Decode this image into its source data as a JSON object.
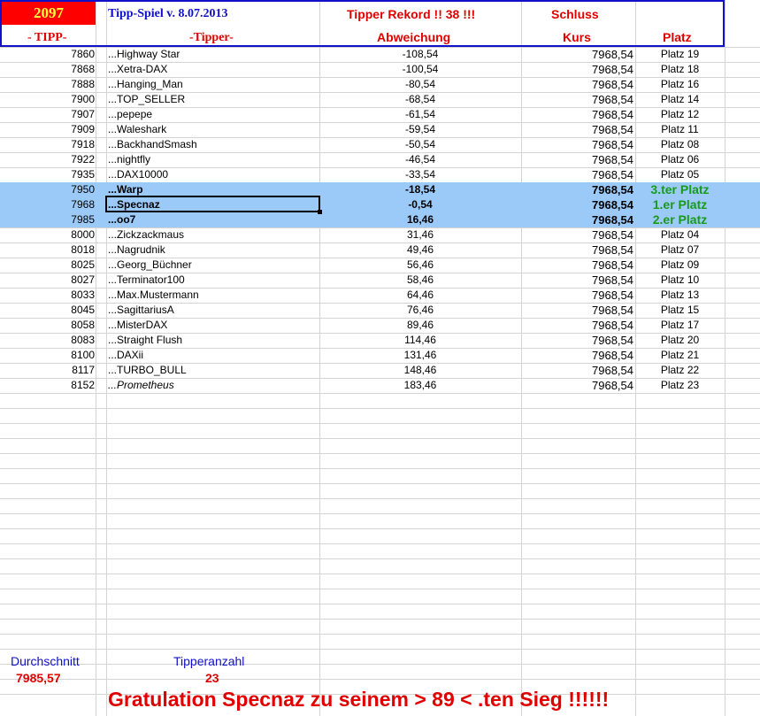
{
  "header": {
    "year": "2097",
    "title": "Tipp-Spiel v. 8.07.2013",
    "rekord": "Tipper Rekord !!  38  !!!",
    "schluss": "Schluss",
    "col_tipp": "- TIPP-",
    "col_tipper": "-Tipper-",
    "col_abweichung": "Abweichung",
    "col_kurs": "Kurs",
    "col_platz": "Platz"
  },
  "rows": [
    {
      "tipp": "7860",
      "name": "...Highway Star",
      "abw": "-108,54",
      "kurs": "7968,54",
      "platz": "Platz 19"
    },
    {
      "tipp": "7868",
      "name": "...Xetra-DAX",
      "abw": "-100,54",
      "kurs": "7968,54",
      "platz": "Platz 18"
    },
    {
      "tipp": "7888",
      "name": "...Hanging_Man",
      "abw": "-80,54",
      "kurs": "7968,54",
      "platz": "Platz 16"
    },
    {
      "tipp": "7900",
      "name": "...TOP_SELLER",
      "abw": "-68,54",
      "kurs": "7968,54",
      "platz": "Platz 14"
    },
    {
      "tipp": "7907",
      "name": "...pepepe",
      "abw": "-61,54",
      "kurs": "7968,54",
      "platz": "Platz 12"
    },
    {
      "tipp": "7909",
      "name": "...Waleshark",
      "abw": "-59,54",
      "kurs": "7968,54",
      "platz": "Platz 11"
    },
    {
      "tipp": "7918",
      "name": "...BackhandSmash",
      "abw": "-50,54",
      "kurs": "7968,54",
      "platz": "Platz 08"
    },
    {
      "tipp": "7922",
      "name": "...nightfly",
      "abw": "-46,54",
      "kurs": "7968,54",
      "platz": "Platz 06"
    },
    {
      "tipp": "7935",
      "name": "...DAX10000",
      "abw": "-33,54",
      "kurs": "7968,54",
      "platz": "Platz 05"
    },
    {
      "tipp": "7950",
      "name": "...Warp",
      "abw": "-18,54",
      "kurs": "7968,54",
      "platz": "3.ter Platz",
      "hl": true
    },
    {
      "tipp": "7968",
      "name": "...Specnaz",
      "abw": "-0,54",
      "kurs": "7968,54",
      "platz": "1.er Platz",
      "hl": true
    },
    {
      "tipp": "7985",
      "name": "...oo7",
      "abw": "16,46",
      "kurs": "7968,54",
      "platz": "2.er Platz",
      "hl": true
    },
    {
      "tipp": "8000",
      "name": "...Zickzackmaus",
      "abw": "31,46",
      "kurs": "7968,54",
      "platz": "Platz 04"
    },
    {
      "tipp": "8018",
      "name": " ...Nagrudnik",
      "abw": "49,46",
      "kurs": "7968,54",
      "platz": "Platz 07"
    },
    {
      "tipp": "8025",
      "name": "...Georg_Büchner",
      "abw": "56,46",
      "kurs": "7968,54",
      "platz": "Platz 09"
    },
    {
      "tipp": "8027",
      "name": "...Terminator100",
      "abw": "58,46",
      "kurs": "7968,54",
      "platz": "Platz 10"
    },
    {
      "tipp": "8033",
      "name": "...Max.Mustermann",
      "abw": "64,46",
      "kurs": "7968,54",
      "platz": "Platz 13"
    },
    {
      "tipp": "8045",
      "name": "...SagittariusA",
      "abw": "76,46",
      "kurs": "7968,54",
      "platz": "Platz 15"
    },
    {
      "tipp": "8058",
      "name": "...MisterDAX",
      "abw": "89,46",
      "kurs": "7968,54",
      "platz": "Platz 17"
    },
    {
      "tipp": "8083",
      "name": "...Straight Flush",
      "abw": "114,46",
      "kurs": "7968,54",
      "platz": "Platz 20"
    },
    {
      "tipp": "8100",
      "name": "...DAXii",
      "abw": "131,46",
      "kurs": "7968,54",
      "platz": "Platz 21"
    },
    {
      "tipp": "8117",
      "name": "...TURBO_BULL",
      "abw": "148,46",
      "kurs": "7968,54",
      "platz": "Platz 22"
    },
    {
      "tipp": "8152",
      "name": "...Prometheus",
      "abw": "183,46",
      "kurs": "7968,54",
      "platz": "Platz 23",
      "italic": true
    }
  ],
  "footer": {
    "durchschnitt_label": "Durchschnitt",
    "durchschnitt_value": "7985,57",
    "tipperanzahl_label": "Tipperanzahl",
    "tipperanzahl_value": "23",
    "gratulation": "Gratulation Specnaz zu seinem > 89 < .ten Sieg !!!!!!"
  },
  "colors": {
    "header_border": "#1010c8",
    "year_bg": "#ff0000",
    "highlight_bg": "#9ccaf8",
    "podium_text": "#1a9a1a",
    "red_text": "#e00000"
  }
}
